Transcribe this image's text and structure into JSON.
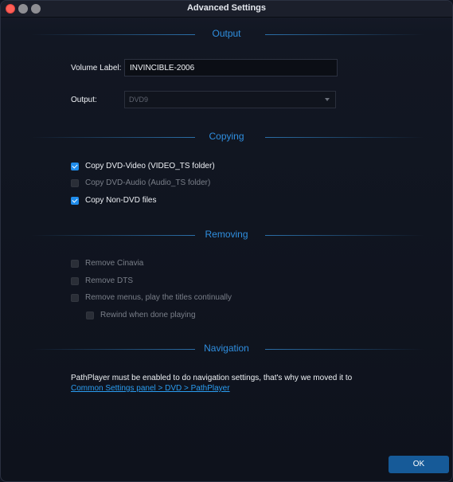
{
  "window": {
    "title": "Advanced Settings"
  },
  "output": {
    "heading": "Output",
    "volume_label": "Volume Label:",
    "volume_value": "INVINCIBLE-2006",
    "output_label": "Output:",
    "output_value": "DVD9"
  },
  "copying": {
    "heading": "Copying",
    "items": [
      {
        "label": "Copy DVD-Video (VIDEO_TS folder)",
        "checked": true,
        "enabled": true
      },
      {
        "label": "Copy DVD-Audio (Audio_TS folder)",
        "checked": false,
        "enabled": false
      },
      {
        "label": "Copy Non-DVD files",
        "checked": true,
        "enabled": true
      }
    ]
  },
  "removing": {
    "heading": "Removing",
    "items": [
      {
        "label": "Remove Cinavia",
        "checked": false,
        "enabled": false
      },
      {
        "label": "Remove DTS",
        "checked": false,
        "enabled": false
      },
      {
        "label": "Remove menus, play the titles continually",
        "checked": false,
        "enabled": false
      },
      {
        "label": "Rewind when done playing",
        "checked": false,
        "enabled": false
      }
    ]
  },
  "navigation": {
    "heading": "Navigation",
    "message": "PathPlayer must be enabled to do navigation settings, that's why we moved it to",
    "link": "Common Settings panel > DVD > PathPlayer"
  },
  "footer": {
    "ok_label": "OK"
  },
  "colors": {
    "accent": "#2f8fe0",
    "checkbox_on": "#1f8ceb",
    "button": "#165a98"
  }
}
